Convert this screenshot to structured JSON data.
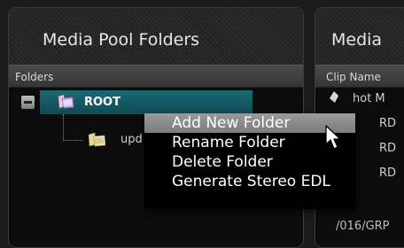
{
  "left_panel": {
    "title": "Media Pool Folders",
    "column_header": "Folders",
    "tree": {
      "root_label": "ROOT",
      "child_label": "upd"
    }
  },
  "right_panel": {
    "title": "Media",
    "column_header": "Clip Name",
    "rows": [
      {
        "text": "hot M"
      },
      {
        "text": "RD"
      },
      {
        "text": "RD"
      },
      {
        "text": "RD"
      }
    ],
    "path_text": "/016/GRP"
  },
  "context_menu": {
    "items": [
      {
        "label": "Add New Folder"
      },
      {
        "label": "Rename Folder"
      },
      {
        "label": "Delete Folder"
      },
      {
        "label": "Generate Stereo EDL"
      }
    ]
  },
  "colors": {
    "selection_teal": "#155c66",
    "menu_highlight": "#8c8c8c"
  }
}
